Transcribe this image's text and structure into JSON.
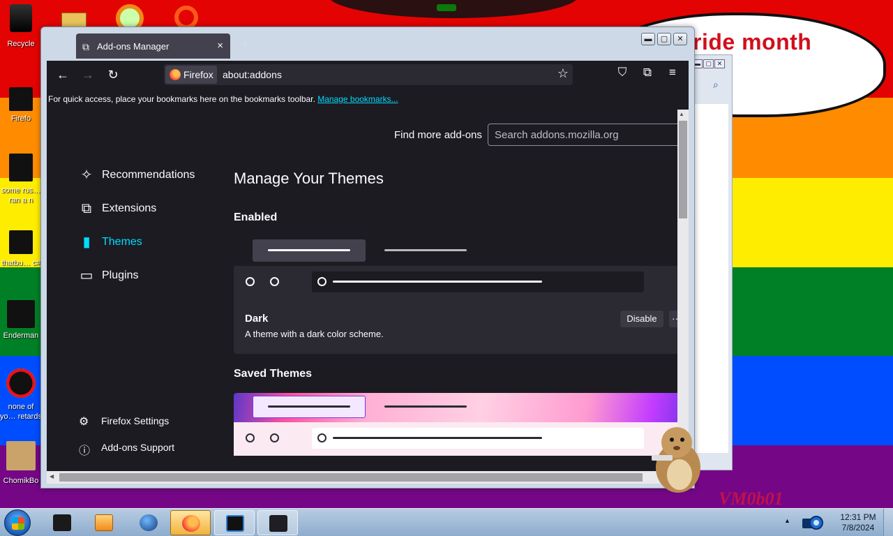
{
  "desktop": {
    "icons": [
      {
        "label": "Recycle"
      },
      {
        "label": "Firefo"
      },
      {
        "label": "some rus… ran a n"
      },
      {
        "label": "thatbu… c#"
      },
      {
        "label": "Enderman"
      },
      {
        "label": "none of yo… retards kn"
      },
      {
        "label": "ChomikBo"
      }
    ],
    "bubble_text": "ride month",
    "corner_text": "VM0b01"
  },
  "window": {
    "tab_title": "Add-ons Manager",
    "tab_icon": "puzzle-icon",
    "controls": {
      "minimize": "▬",
      "maximize": "▢",
      "close": "✕"
    }
  },
  "toolbar": {
    "identity_label": "Firefox",
    "url": "about:addons",
    "bookmarks_hint": "For quick access, place your bookmarks here on the bookmarks toolbar.",
    "bookmarks_link": "Manage bookmarks..."
  },
  "addons": {
    "find_more_label": "Find more add-ons",
    "search_placeholder": "Search addons.mozilla.org",
    "nav": [
      {
        "label": "Recommendations",
        "icon": "sparkles-icon"
      },
      {
        "label": "Extensions",
        "icon": "puzzle-icon"
      },
      {
        "label": "Themes",
        "icon": "brush-icon",
        "active": true
      },
      {
        "label": "Plugins",
        "icon": "plugin-icon"
      }
    ],
    "footer": [
      {
        "label": "Firefox Settings",
        "icon": "gear-icon"
      },
      {
        "label": "Add-ons Support",
        "icon": "help-icon"
      }
    ],
    "page_title": "Manage Your Themes",
    "enabled_heading": "Enabled",
    "enabled_theme": {
      "name": "Dark",
      "description": "A theme with a dark color scheme.",
      "action": "Disable",
      "more": "···"
    },
    "saved_heading": "Saved Themes"
  },
  "taskbar": {
    "time": "12:31 PM",
    "date": "7/8/2024"
  },
  "colors": {
    "accent": "#00ddff",
    "panel": "#1c1b22",
    "card": "#2b2a33"
  }
}
